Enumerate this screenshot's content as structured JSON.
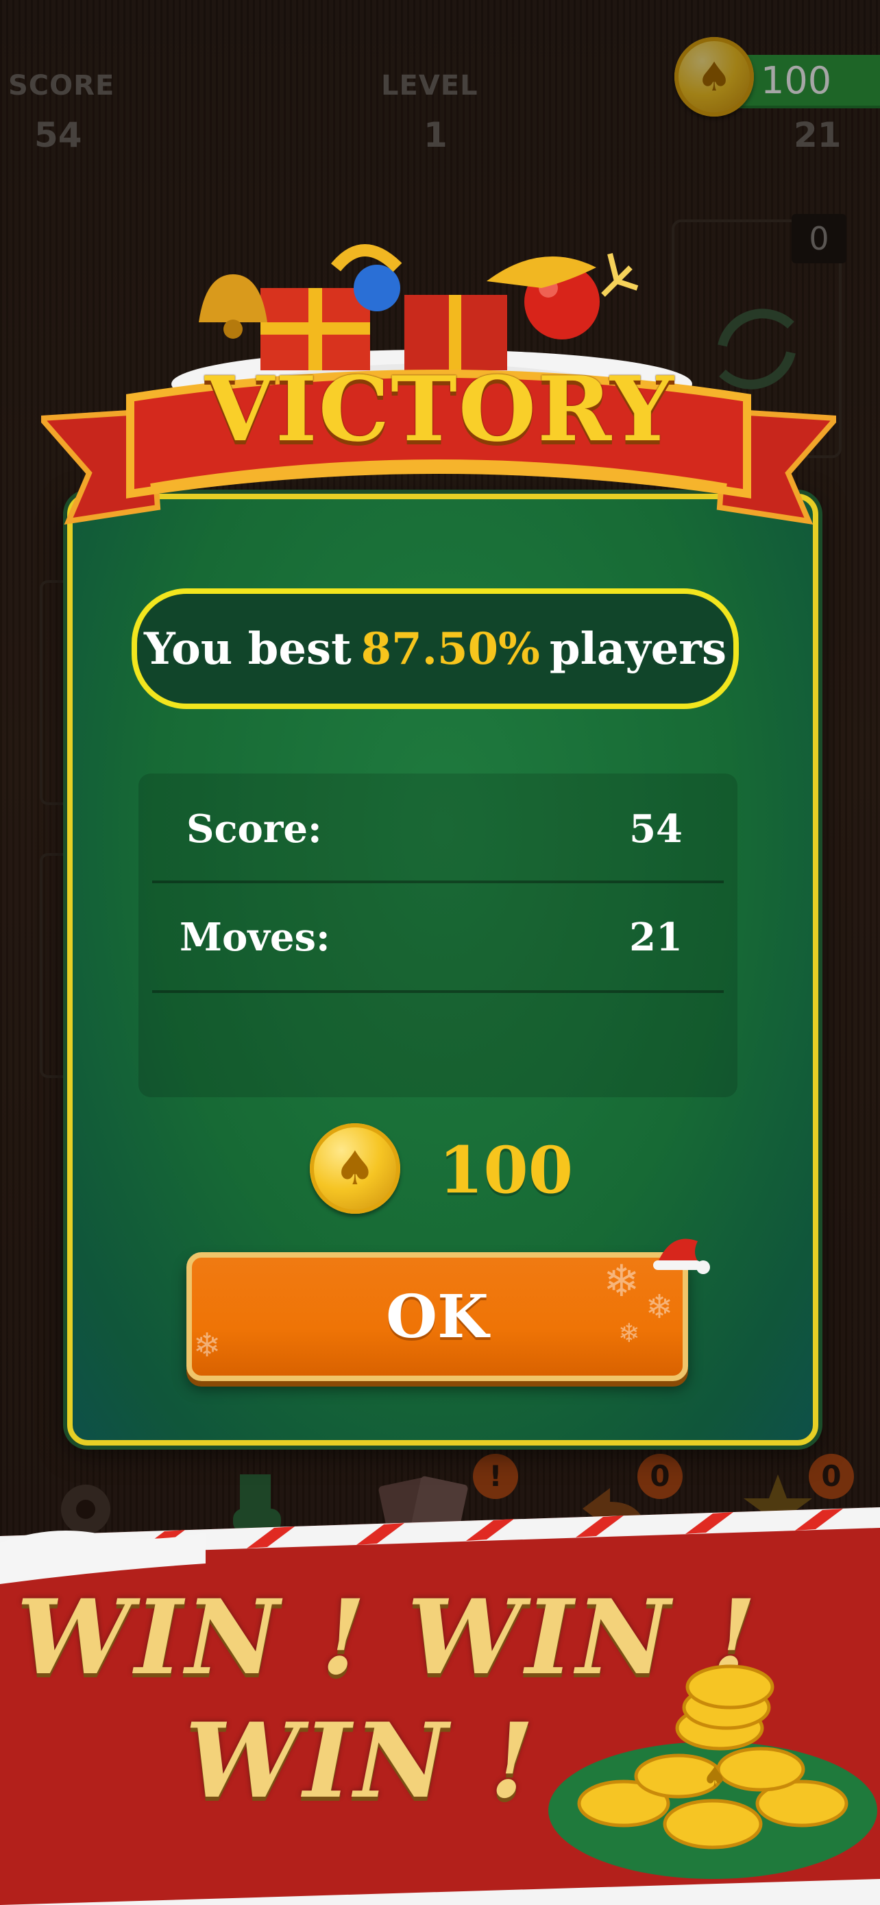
{
  "hud": {
    "score_label": "SCORE",
    "score_value": "54",
    "level_label": "LEVEL",
    "level_value": "1",
    "coins_value": "100",
    "moves_value": "21",
    "stock_count": "0"
  },
  "dialog": {
    "title": "VICTORY",
    "best_prefix": "You best",
    "best_percent": "87.50%",
    "best_suffix": "players",
    "stats": [
      {
        "label": "Score:",
        "value": "54"
      },
      {
        "label": "Moves:",
        "value": "21"
      }
    ],
    "reward_amount": "100",
    "ok_label": "OK"
  },
  "toolbar": {
    "badges": [
      "!",
      "0",
      "0"
    ]
  },
  "promo": {
    "line1": "WIN ! WIN !",
    "line2": "WIN !"
  },
  "colors": {
    "panel_green": "#176a35",
    "panel_border": "#e7cf25",
    "highlight_yellow": "#f7c51d",
    "button_orange": "#ef7406",
    "banner_red": "#c8261c",
    "coin_pill_green": "#2e9b3d"
  }
}
